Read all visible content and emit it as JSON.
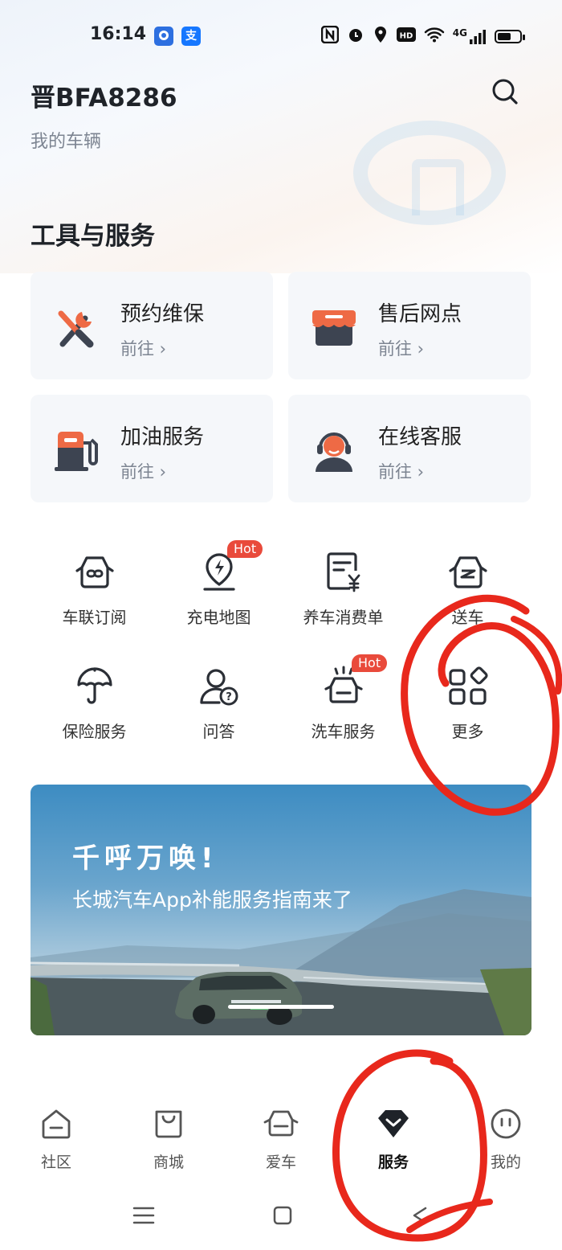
{
  "status_bar": {
    "time": "16:14",
    "alipay_icon_text": "支",
    "network": "4G"
  },
  "header": {
    "plate": "晋BFA8286",
    "subtitle": "我的车辆"
  },
  "tools": {
    "title": "工具与服务",
    "cards": [
      {
        "title": "预约维保",
        "link": "前往 ›",
        "icon": "wrench-screwdriver-icon"
      },
      {
        "title": "售后网点",
        "link": "前往 ›",
        "icon": "store-icon"
      },
      {
        "title": "加油服务",
        "link": "前往 ›",
        "icon": "fuel-pump-icon"
      },
      {
        "title": "在线客服",
        "link": "前往 ›",
        "icon": "customer-service-icon"
      }
    ],
    "grid": [
      {
        "label": "车联订阅",
        "icon": "car-link-icon"
      },
      {
        "label": "充电地图",
        "icon": "charging-map-icon",
        "badge": "Hot"
      },
      {
        "label": "养车消费单",
        "icon": "bill-icon"
      },
      {
        "label": "送车",
        "icon": "car-delivery-icon"
      },
      {
        "label": "保险服务",
        "icon": "umbrella-icon"
      },
      {
        "label": "问答",
        "icon": "qa-icon"
      },
      {
        "label": "洗车服务",
        "icon": "car-wash-icon",
        "badge": "Hot"
      },
      {
        "label": "更多",
        "icon": "more-grid-icon"
      }
    ]
  },
  "banner": {
    "title": "千呼万唤!",
    "subtitle": "长城汽车App补能服务指南来了"
  },
  "tabbar": {
    "tabs": [
      {
        "label": "社区",
        "active": false
      },
      {
        "label": "商城",
        "active": false
      },
      {
        "label": "爱车",
        "active": false
      },
      {
        "label": "服务",
        "active": true
      },
      {
        "label": "我的",
        "active": false
      }
    ]
  },
  "colors": {
    "accent_red": "#e94a3b",
    "orange": "#ee6a45",
    "dark_icon": "#3d4451",
    "annotation": "#e8281c"
  }
}
